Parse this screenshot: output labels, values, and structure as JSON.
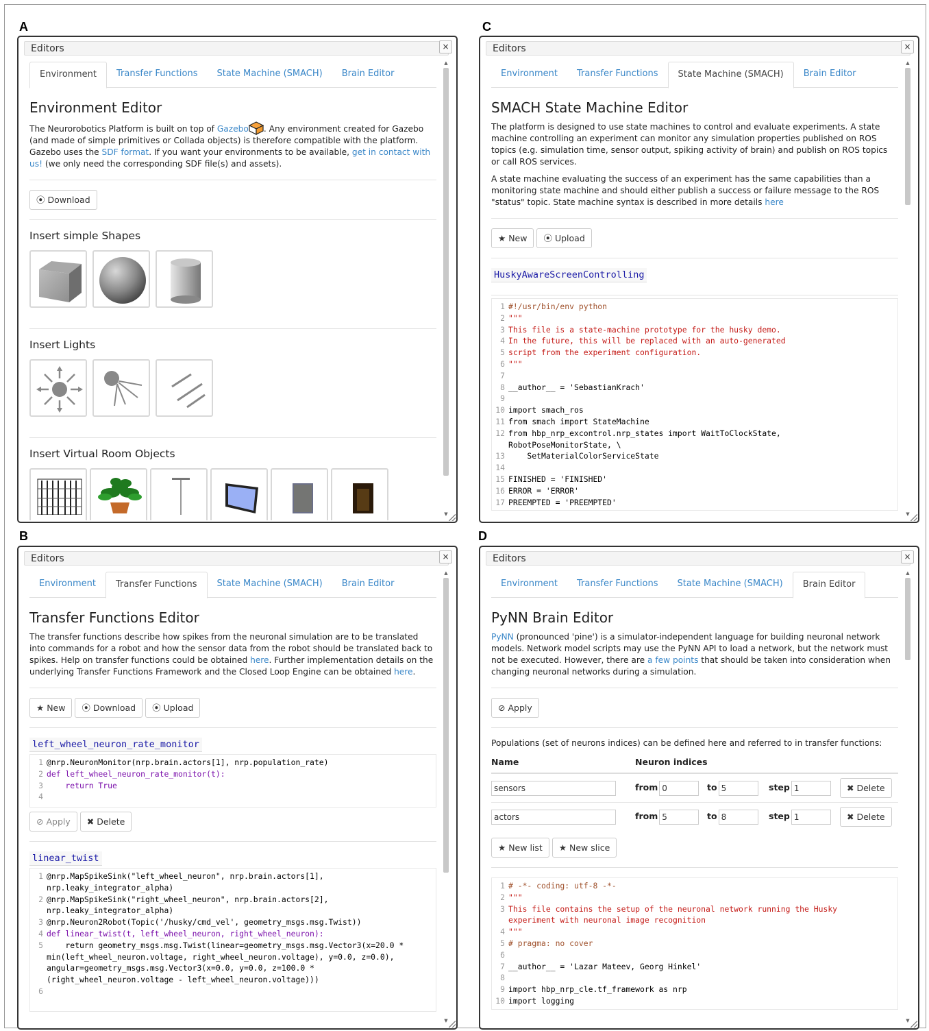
{
  "labels": {
    "a": "A",
    "b": "B",
    "c": "C",
    "d": "D"
  },
  "window": {
    "title": "Editors",
    "close": "×"
  },
  "tabs": [
    "Environment",
    "Transfer Functions",
    "State Machine (SMACH)",
    "Brain Editor"
  ],
  "panelA": {
    "heading": "Environment Editor",
    "desc1": "The Neurorobotics Platform is built on top of ",
    "gazebo_link": "Gazebo",
    "desc2": ". Any environment created for Gazebo (and made of simple primitives or Collada objects) is therefore compatible with the platform. Gazebo uses the ",
    "sdf_link": "SDF format",
    "desc3": ". If you want your environments to be available, ",
    "contact_link": "get in contact with us!",
    "desc4": " (we only need the corresponding SDF file(s) and assets).",
    "download": "Download",
    "shapes_title": "Insert simple Shapes",
    "lights_title": "Insert Lights",
    "room_title": "Insert Virtual Room Objects"
  },
  "panelB": {
    "heading": "Transfer Functions Editor",
    "desc1": "The transfer functions describe how spikes from the neuronal simulation are to be translated into commands for a robot and how the sensor data from the robot should be translated back to spikes. Help on transfer functions could be obtained ",
    "here1": "here",
    "desc2": ". Further implementation details on the underlying Transfer Functions Framework and the Closed Loop Engine can be obtained ",
    "here2": "here",
    "desc3": ".",
    "new": "New",
    "download": "Download",
    "upload": "Upload",
    "tf1_name": "left_wheel_neuron_rate_monitor",
    "tf1_code": [
      "@nrp.NeuronMonitor(nrp.brain.actors[1], nrp.population_rate)",
      "def left_wheel_neuron_rate_monitor(t):",
      "    return True",
      ""
    ],
    "apply": "Apply",
    "delete": "Delete",
    "tf2_name": "linear_twist",
    "tf2_code": [
      "@nrp.MapSpikeSink(\"left_wheel_neuron\", nrp.brain.actors[1],",
      "nrp.leaky_integrator_alpha)",
      "@nrp.MapSpikeSink(\"right_wheel_neuron\", nrp.brain.actors[2],",
      "nrp.leaky_integrator_alpha)",
      "@nrp.Neuron2Robot(Topic('/husky/cmd_vel', geometry_msgs.msg.Twist))",
      "def linear_twist(t, left_wheel_neuron, right_wheel_neuron):",
      "    return geometry_msgs.msg.Twist(linear=geometry_msgs.msg.Vector3(x=20.0 *",
      "min(left_wheel_neuron.voltage, right_wheel_neuron.voltage), y=0.0, z=0.0),",
      "angular=geometry_msgs.msg.Vector3(x=0.0, y=0.0, z=100.0 *",
      "(right_wheel_neuron.voltage - left_wheel_neuron.voltage)))",
      ""
    ],
    "tf2_nums": [
      "1",
      "",
      "2",
      "",
      "3",
      "4",
      "5",
      "",
      "",
      "",
      "6"
    ]
  },
  "panelC": {
    "heading": "SMACH State Machine Editor",
    "desc1": "The platform is designed to use state machines to control and evaluate experiments. A state machine controlling an experiment can monitor any simulation properties published on ROS topics (e.g. simulation time, sensor output, spiking activity of brain) and publish on ROS topics or call ROS services.",
    "desc2": "A state machine evaluating the success of an experiment has the same capabilities than a monitoring state machine and should either publish a success or failure message to the ROS \"status\" topic. State machine syntax is described in more details ",
    "here": "here",
    "new": "New",
    "upload": "Upload",
    "sm_name": "HuskyAwareScreenControlling",
    "code": [
      "#!/usr/bin/env python",
      "\"\"\"",
      "This file is a state-machine prototype for the husky demo.",
      "In the future, this will be replaced with an auto-generated",
      "script from the experiment configuration.",
      "\"\"\"",
      "",
      "__author__ = 'SebastianKrach'",
      "",
      "import smach_ros",
      "from smach import StateMachine",
      "from hbp_nrp_excontrol.nrp_states import WaitToClockState,",
      "RobotPoseMonitorState, \\",
      "    SetMaterialColorServiceState",
      "",
      "FINISHED = 'FINISHED'",
      "ERROR = 'ERROR'",
      "PREEMPTED = 'PREEMPTED'"
    ],
    "nums": [
      "1",
      "2",
      "3",
      "4",
      "5",
      "6",
      "7",
      "8",
      "9",
      "10",
      "11",
      "12",
      "",
      "13",
      "14",
      "15",
      "16",
      "17"
    ]
  },
  "panelD": {
    "heading": "PyNN Brain Editor",
    "pynn_link": "PyNN",
    "desc1": " (pronounced 'pine') is a simulator-independent language for building neuronal network models. Network model scripts may use the PyNN API to load a network, but the network must not be executed. However, there are ",
    "points_link": "a few points",
    "desc2": " that should be taken into consideration when changing neuronal networks during a simulation.",
    "apply": "Apply",
    "pop_intro": "Populations (set of neurons indices) can be defined here and referred to in transfer functions:",
    "col_name": "Name",
    "col_indices": "Neuron indices",
    "from": "from",
    "to": "to",
    "step": "step",
    "delete": "Delete",
    "rows": [
      {
        "name": "sensors",
        "from": "0",
        "to": "5",
        "step": "1"
      },
      {
        "name": "actors",
        "from": "5",
        "to": "8",
        "step": "1"
      }
    ],
    "new_list": "New list",
    "new_slice": "New slice",
    "code": [
      "# -*- coding: utf-8 -*-",
      "\"\"\"",
      "This file contains the setup of the neuronal network running the Husky",
      "experiment with neuronal image recognition",
      "\"\"\"",
      "# pragma: no cover",
      "",
      "__author__ = 'Lazar Mateev, Georg Hinkel'",
      "",
      "import hbp_nrp_cle.tf_framework as nrp",
      "import logging"
    ],
    "nums": [
      "1",
      "2",
      "3",
      "",
      "4",
      "5",
      "6",
      "7",
      "8",
      "9",
      "10"
    ]
  },
  "colors": {
    "link": "#3a87c8",
    "code_string": "#c41a16",
    "code_keyword": "#7a0eaa"
  }
}
